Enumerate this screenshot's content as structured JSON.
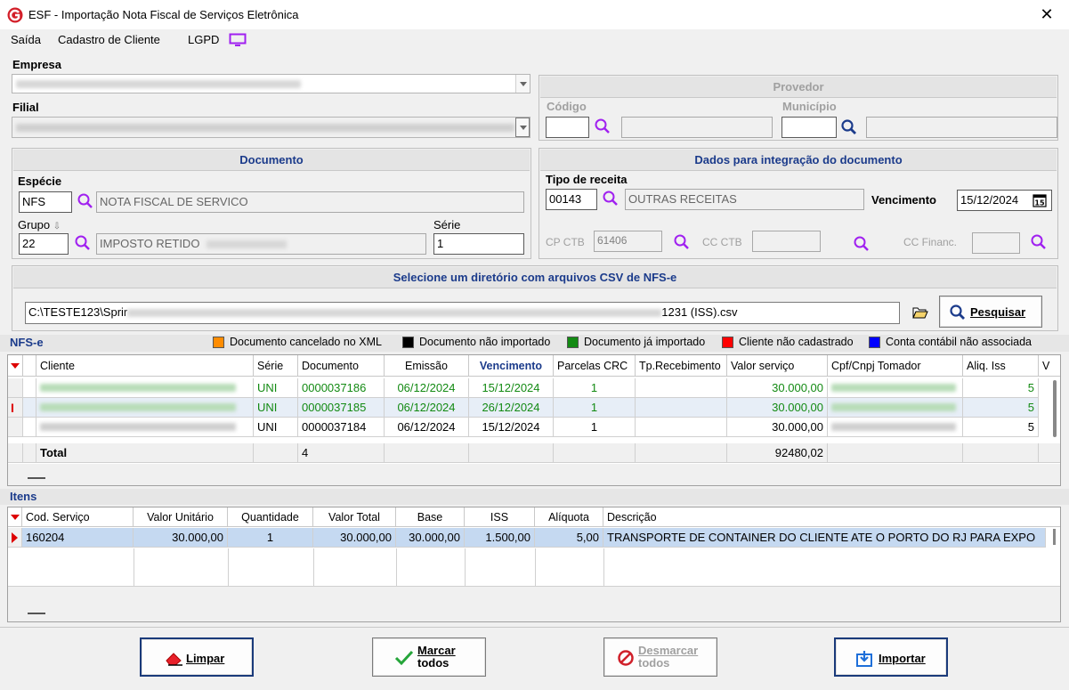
{
  "window": {
    "title": "ESF - Importação Nota Fiscal de Serviços Eletrônica",
    "close": "✕"
  },
  "menu": {
    "saida": "Saída",
    "cadastro": "Cadastro de Cliente",
    "lgpd": "LGPD"
  },
  "empresa": {
    "label": "Empresa"
  },
  "filial": {
    "label": "Filial"
  },
  "provedor": {
    "header": "Provedor",
    "codigo_label": "Código",
    "municipio_label": "Município"
  },
  "documento": {
    "header": "Documento",
    "especie_label": "Espécie",
    "especie_code": "NFS",
    "especie_desc": "NOTA FISCAL DE SERVICO",
    "grupo_label": "Grupo",
    "grupo_code": "22",
    "grupo_desc": "IMPOSTO RETIDO",
    "serie_label": "Série",
    "serie_value": "1"
  },
  "integracao": {
    "header": "Dados para integração do documento",
    "tipo_label": "Tipo de receita",
    "tipo_code": "00143",
    "tipo_desc": "OUTRAS RECEITAS",
    "venc_label": "Vencimento",
    "venc_value": "15/12/2024",
    "cpctb_label": "CP CTB",
    "cpctb_value": "61406",
    "ccctb_label": "CC CTB",
    "ccfin_label": "CC Financ."
  },
  "diretorio": {
    "header": "Selecione um diretório com arquivos CSV de NFS-e",
    "path_start": "C:\\TESTE123\\Sprir",
    "path_end": "1231 (ISS).csv",
    "search_label": "Pesquisar"
  },
  "nfse": {
    "title": "NFS-e",
    "legend": [
      {
        "color": "#ff8c00",
        "label": "Documento cancelado no XML"
      },
      {
        "color": "#000000",
        "label": "Documento não importado"
      },
      {
        "color": "#138a13",
        "label": "Documento já importado"
      },
      {
        "color": "#ff0000",
        "label": "Cliente não cadastrado"
      },
      {
        "color": "#0000ff",
        "label": "Conta contábil não associada"
      }
    ],
    "columns": [
      "Cliente",
      "Série",
      "Documento",
      "Emissão",
      "Vencimento",
      "Parcelas CRC",
      "Tp.Recebimento",
      "Valor serviço",
      "Cpf/Cnpj Tomador",
      "Aliq. Iss",
      "V"
    ],
    "rows": [
      {
        "serie": "UNI",
        "documento": "0000037186",
        "emissao": "06/12/2024",
        "vencimento": "15/12/2024",
        "parcelas": "1",
        "valor": "30.000,00",
        "aliq": "5"
      },
      {
        "serie": "UNI",
        "documento": "0000037185",
        "emissao": "06/12/2024",
        "vencimento": "26/12/2024",
        "parcelas": "1",
        "valor": "30.000,00",
        "aliq": "5"
      },
      {
        "serie": "UNI",
        "documento": "0000037184",
        "emissao": "06/12/2024",
        "vencimento": "15/12/2024",
        "parcelas": "1",
        "valor": "30.000,00",
        "aliq": "5"
      }
    ],
    "total_label": "Total",
    "total_count": "4",
    "total_valor": "92480,02"
  },
  "itens": {
    "title": "Itens",
    "columns": [
      "Cod. Serviço",
      "Valor Unitário",
      "Quantidade",
      "Valor Total",
      "Base",
      "ISS",
      "Alíquota",
      "Descrição"
    ],
    "rows": [
      {
        "cod": "160204",
        "unit": "30.000,00",
        "qtd": "1",
        "total": "30.000,00",
        "base": "30.000,00",
        "iss": "1.500,00",
        "aliq": "5,00",
        "desc": "TRANSPORTE DE CONTAINER DO CLIENTE ATE O PORTO DO RJ PARA EXPO"
      }
    ]
  },
  "buttons": {
    "limpar": "Limpar",
    "marcar_1": "Marcar",
    "marcar_2": "todos",
    "desmarcar_1": "Desmarcar",
    "desmarcar_2": "todos",
    "importar": "Importar"
  },
  "colors": {
    "accent": "#1b3b8b",
    "selection": "#c5d9f1",
    "icon_purple": "#a020f0"
  }
}
